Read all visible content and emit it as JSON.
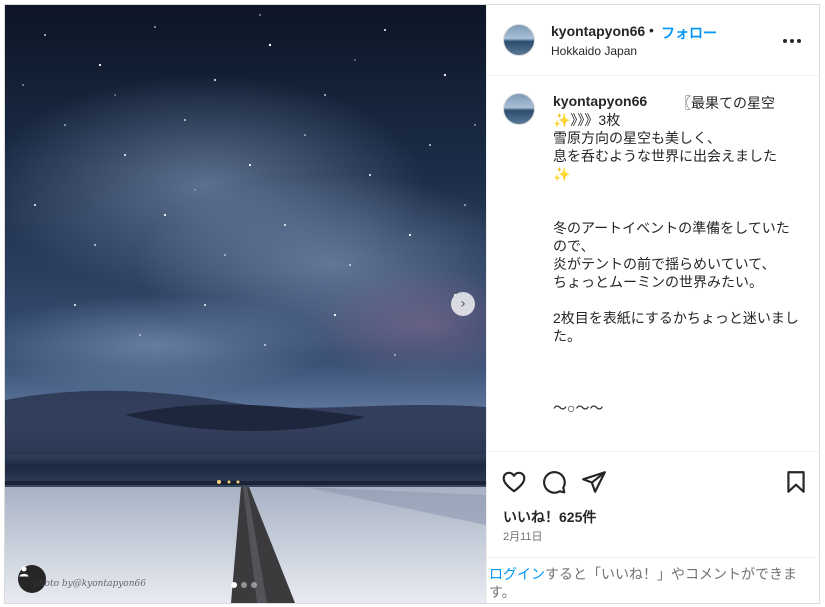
{
  "post": {
    "author": {
      "username": "kyontapyon66",
      "separator": "•",
      "follow_label": "フォロー",
      "location": "Hokkaido Japan"
    },
    "media": {
      "watermark": "photo by@kyontapyon66",
      "carousel": {
        "count": 3,
        "current": 1
      },
      "next_icon": "chevron-right-icon",
      "tag_icon": "user-tag-icon"
    },
    "caption": {
      "username": "kyontapyon66",
      "title": "〖最果ての星空",
      "body_line1": "✨》》》3枚",
      "body": "\n雪原方向の星空も美しく、\n息を呑むような世界に出会えました\n✨\n\n\n冬のアートイベントの準備をしていたので、\n炎がテントの前で揺らめいていて、\nちょっとムーミンの世界みたい。\n\n2枚目を表紙にするかちょっと迷いました。\n\n\n\n～○～～"
    },
    "actions": {
      "icons": [
        "heart-icon",
        "comment-icon",
        "share-icon",
        "bookmark-icon"
      ],
      "likes_text": "いいね！625件",
      "date": "2月11日"
    },
    "login_prompt": {
      "link": "ログイン",
      "text": "すると「いいね！」やコメントができます。"
    }
  },
  "colors": {
    "accent": "#0095f6",
    "text": "#262626",
    "muted": "#737373",
    "border": "#dbdbdb"
  }
}
